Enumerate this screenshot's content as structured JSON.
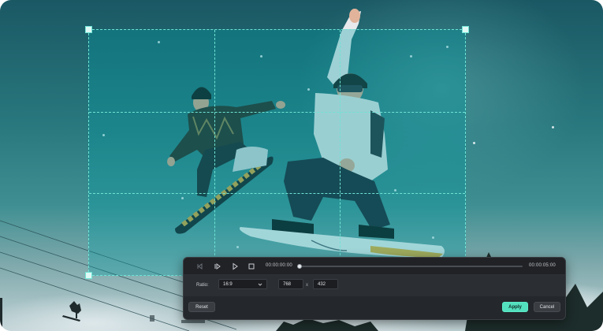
{
  "crop_editor": {
    "playback": {
      "prev_frame_icon": "prev-frame-icon",
      "play_clip_icon": "play-clip-icon",
      "play_icon": "play-icon",
      "stop_icon": "stop-icon",
      "current_time": "00:00:00:00",
      "end_time": "00:00:05:00"
    },
    "ratio": {
      "label": "Ratio:",
      "selected": "16:9",
      "width": "768",
      "separator": "x",
      "height": "432"
    },
    "buttons": {
      "reset": "Reset",
      "apply": "Apply",
      "cancel": "Cancel"
    },
    "colors": {
      "accent": "#53e0be",
      "crop_guide": "#6fe3d4",
      "panel_bg": "#24272b"
    }
  }
}
